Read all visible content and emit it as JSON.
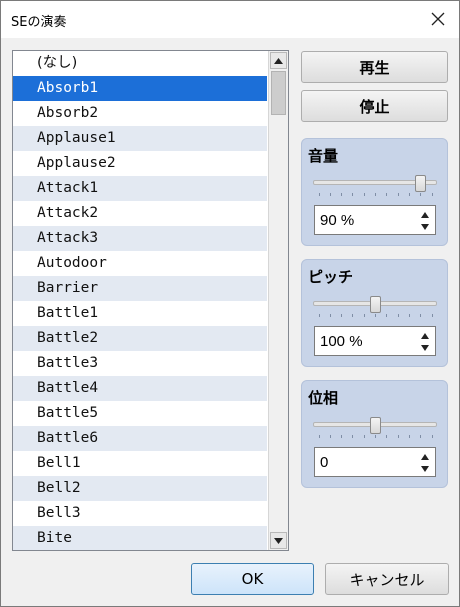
{
  "window": {
    "title": "SEの演奏"
  },
  "list": {
    "items": [
      "(なし)",
      "Absorb1",
      "Absorb2",
      "Applause1",
      "Applause2",
      "Attack1",
      "Attack2",
      "Attack3",
      "Autodoor",
      "Barrier",
      "Battle1",
      "Battle2",
      "Battle3",
      "Battle4",
      "Battle5",
      "Battle6",
      "Bell1",
      "Bell2",
      "Bell3",
      "Bite"
    ],
    "selected": "Absorb1"
  },
  "buttons": {
    "play": "再生",
    "stop": "停止",
    "ok": "OK",
    "cancel": "キャンセル"
  },
  "volume": {
    "label": "音量",
    "value": "90 %",
    "level": 90
  },
  "pitch": {
    "label": "ピッチ",
    "value": "100 %",
    "level": 100
  },
  "pan": {
    "label": "位相",
    "value": "0",
    "level": 0
  },
  "colors": {
    "selection": "#1c6fd8",
    "group_bg": "#c8d4e8",
    "row_alt": "#e3e9f2"
  }
}
